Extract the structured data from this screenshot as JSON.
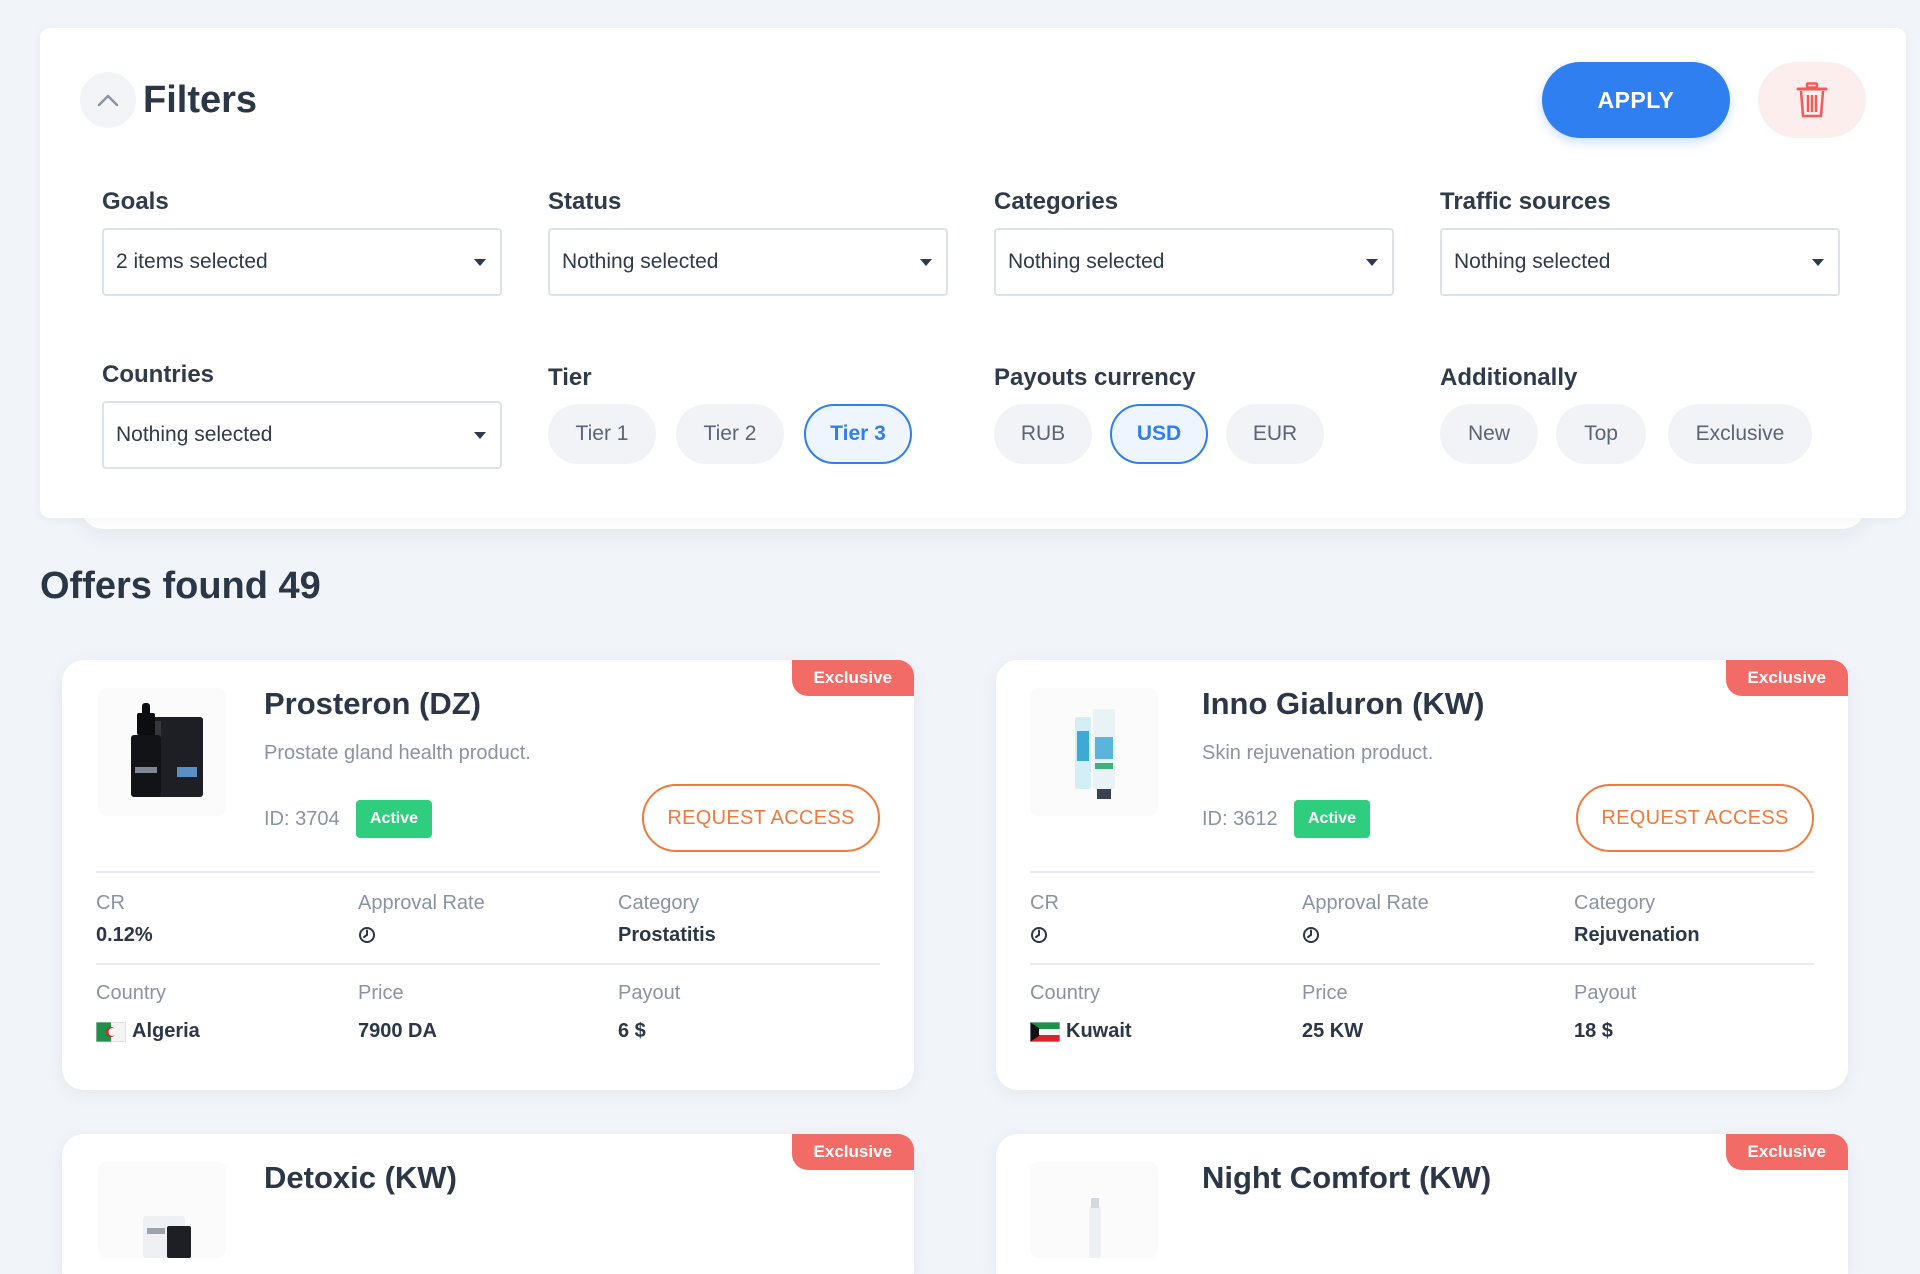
{
  "filters": {
    "title": "Filters",
    "apply_label": "APPLY",
    "goals": {
      "label": "Goals",
      "value": "2 items selected"
    },
    "status": {
      "label": "Status",
      "value": "Nothing selected"
    },
    "categories": {
      "label": "Categories",
      "value": "Nothing selected"
    },
    "traffic_sources": {
      "label": "Traffic sources",
      "value": "Nothing selected"
    },
    "countries": {
      "label": "Countries",
      "value": "Nothing selected"
    },
    "tier": {
      "label": "Tier",
      "options": [
        "Tier 1",
        "Tier 2",
        "Tier 3"
      ],
      "selected": "Tier 3"
    },
    "payouts_currency": {
      "label": "Payouts currency",
      "options": [
        "RUB",
        "USD",
        "EUR"
      ],
      "selected": "USD"
    },
    "additionally": {
      "label": "Additionally",
      "options": [
        "New",
        "Top",
        "Exclusive"
      ]
    }
  },
  "offers": {
    "heading": "Offers found 49",
    "request_label": "REQUEST ACCESS",
    "stat_labels": {
      "cr": "CR",
      "approval_rate": "Approval Rate",
      "category": "Category",
      "country": "Country",
      "price": "Price",
      "payout": "Payout"
    },
    "items": [
      {
        "tag": "Exclusive",
        "name": "Prosteron (DZ)",
        "description": "Prostate gland health product.",
        "id_text": "ID: 3704",
        "status": "Active",
        "cr": "0.12%",
        "category": "Prostatitis",
        "country": "Algeria",
        "price": "7900 DA",
        "payout": "6 $"
      },
      {
        "tag": "Exclusive",
        "name": "Inno Gialuron (KW)",
        "description": "Skin rejuvenation product.",
        "id_text": "ID: 3612",
        "status": "Active",
        "category": "Rejuvenation",
        "country": "Kuwait",
        "price": "25 KW",
        "payout": "18 $"
      },
      {
        "tag": "Exclusive",
        "name": "Detoxic (KW)"
      },
      {
        "tag": "Exclusive",
        "name": "Night Comfort (KW)"
      }
    ]
  },
  "colors": {
    "primary": "#2f7ff0",
    "exclusive": "#f26b66",
    "active": "#2fce7f",
    "request": "#f07a3c",
    "delete": "#f05a5a"
  }
}
